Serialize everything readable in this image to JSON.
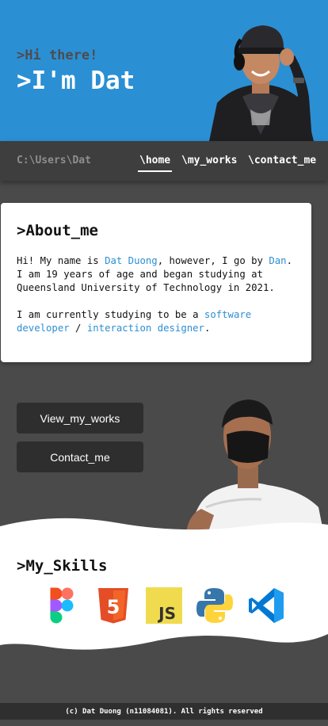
{
  "hero": {
    "greeting": ">Hi there!",
    "name": ">I'm Dat"
  },
  "nav": {
    "path": "C:\\Users\\Dat",
    "links": [
      "\\home",
      "\\my_works",
      "\\contact_me"
    ],
    "active": "\\home"
  },
  "about": {
    "title": ">About_me",
    "p1_a": "Hi! My name is ",
    "p1_name": "Dat Duong",
    "p1_b": ", however, I go by ",
    "p1_nick": "Dan",
    "p1_c": ". I am 19 years of age and began studying at Queensland University of Technology in 2021.",
    "p2_a": "I am currently studying to be a ",
    "p2_role1": "software developer",
    "p2_sep": " / ",
    "p2_role2": "interaction designer",
    "p2_end": "."
  },
  "buttons": {
    "works": "View_my_works",
    "contact": "Contact_me"
  },
  "skills": {
    "title": ">My_Skills",
    "icons": [
      "figma-icon",
      "html5-icon",
      "javascript-icon",
      "python-icon",
      "vscode-icon"
    ],
    "html_label": "5",
    "js_label": "JS"
  },
  "footer": {
    "text": "(c) Dat Duong (n11084081). All rights reserved"
  },
  "colors": {
    "hero_bg": "#2b8fd4",
    "page_bg": "#4a4a4a",
    "nav_bg": "#3e3e3e",
    "accent": "#2c8fd3"
  }
}
